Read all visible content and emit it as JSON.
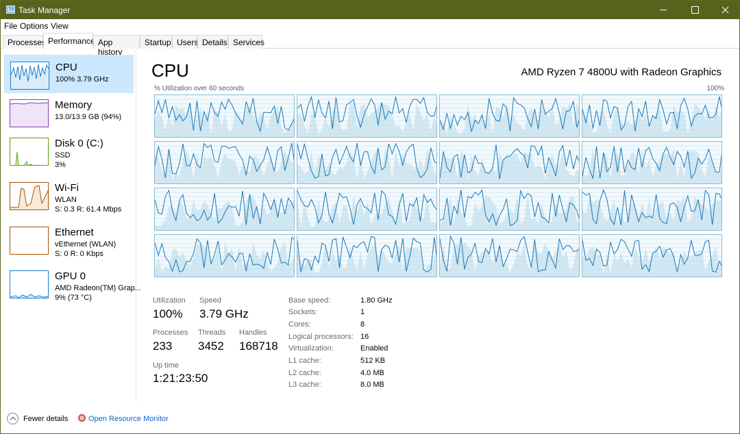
{
  "window": {
    "title": "Task Manager"
  },
  "menu": [
    "File",
    "Options",
    "View"
  ],
  "tabs": [
    "Processes",
    "Performance",
    "App history",
    "Startup",
    "Users",
    "Details",
    "Services"
  ],
  "sidebar": [
    {
      "name": "CPU",
      "lines": [
        "100%  3.79 GHz"
      ],
      "color": "#1c7dc9"
    },
    {
      "name": "Memory",
      "lines": [
        "13.0/13.9 GB (94%)"
      ],
      "color": "#8b3ab8"
    },
    {
      "name": "Disk 0 (C:)",
      "lines": [
        "SSD",
        "3%"
      ],
      "color": "#4da60c"
    },
    {
      "name": "Wi-Fi",
      "lines": [
        "WLAN",
        "S: 0.3  R: 61.4 Mbps"
      ],
      "color": "#a74f01"
    },
    {
      "name": "Ethernet",
      "lines": [
        "vEthernet (WLAN)",
        "S: 0  R: 0 Kbps"
      ],
      "color": "#a74f01"
    },
    {
      "name": "GPU 0",
      "lines": [
        "AMD Radeon(TM) Grap...",
        "9%  (73 °C)"
      ],
      "color": "#1c7dc9"
    }
  ],
  "main": {
    "title": "CPU",
    "model": "AMD Ryzen 7 4800U with Radeon Graphics",
    "graph_label": "% Utilization over 60 seconds",
    "graph_max": "100%",
    "stats": {
      "utilization_label": "Utilization",
      "utilization": "100%",
      "speed_label": "Speed",
      "speed": "3.79 GHz",
      "processes_label": "Processes",
      "processes": "233",
      "threads_label": "Threads",
      "threads": "3452",
      "handles_label": "Handles",
      "handles": "168718",
      "uptime_label": "Up time",
      "uptime": "1:21:23:50"
    },
    "specs": [
      {
        "k": "Base speed:",
        "v": "1.80 GHz"
      },
      {
        "k": "Sockets:",
        "v": "1"
      },
      {
        "k": "Cores:",
        "v": "8"
      },
      {
        "k": "Logical processors:",
        "v": "16"
      },
      {
        "k": "Virtualization:",
        "v": "Enabled"
      },
      {
        "k": "L1 cache:",
        "v": "512 KB"
      },
      {
        "k": "L2 cache:",
        "v": "4.0 MB"
      },
      {
        "k": "L3 cache:",
        "v": "8.0 MB"
      }
    ]
  },
  "footer": {
    "fewer_details": "Fewer details",
    "resource_monitor": "Open Resource Monitor"
  },
  "colors": {
    "accent": "#1c7dc9",
    "titlebar": "#58621d",
    "selection": "#cce8ff",
    "link": "#0e63c4"
  },
  "icons": [
    "app-icon",
    "minimize-icon",
    "maximize-icon",
    "close-icon",
    "chevron-up-icon",
    "resource-monitor-icon"
  ]
}
